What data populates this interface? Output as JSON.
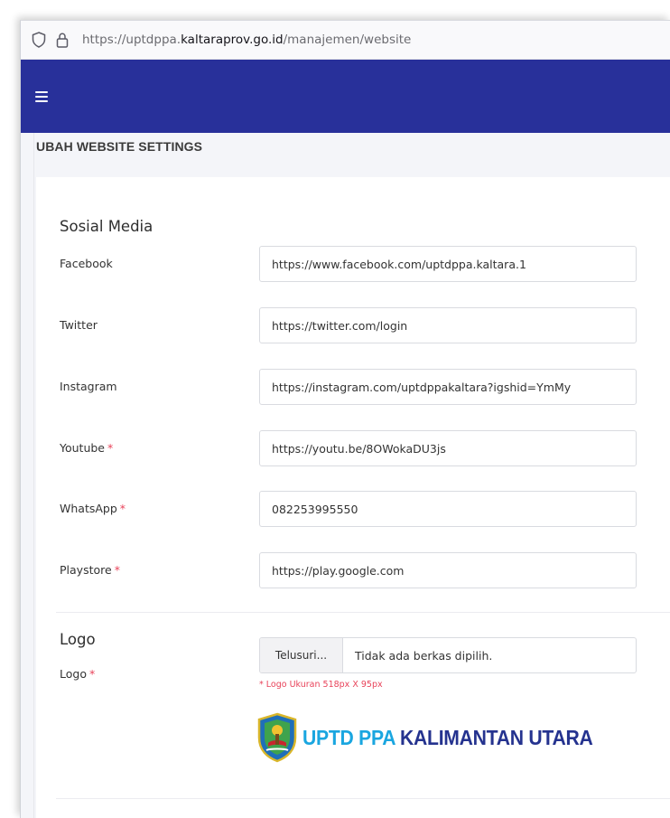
{
  "browser": {
    "url_prefix": "https://uptdppa.",
    "url_domain": "kaltaraprov.go.id",
    "url_path": "/manajemen/website"
  },
  "page": {
    "title": "UBAH WEBSITE SETTINGS"
  },
  "social": {
    "heading": "Sosial Media",
    "fields": [
      {
        "label": "Facebook",
        "required": "",
        "value": "https://www.facebook.com/uptdppa.kaltara.1"
      },
      {
        "label": "Twitter",
        "required": "",
        "value": "https://twitter.com/login"
      },
      {
        "label": "Instagram",
        "required": "",
        "value": "https://instagram.com/uptdppakaltara?igshid=YmMy"
      },
      {
        "label": "Youtube",
        "required": "*",
        "value": "https://youtu.be/8OWokaDU3js"
      },
      {
        "label": "WhatsApp",
        "required": "*",
        "value": "082253995550"
      },
      {
        "label": "Playstore",
        "required": "*",
        "value": "https://play.google.com"
      }
    ]
  },
  "logo": {
    "heading": "Logo",
    "label": "Logo",
    "required": "*",
    "browse_label": "Telusuri...",
    "file_status": "Tidak ada berkas dipilih.",
    "help": "* Logo Ukuran 518px X 95px",
    "brand_part1": "UPTD PPA",
    "brand_part2": "KALIMANTAN UTARA"
  },
  "colors": {
    "navbar": "#28309a",
    "required": "#e8435a",
    "brand_light": "#1aa6e0",
    "brand_dark": "#25338f"
  }
}
